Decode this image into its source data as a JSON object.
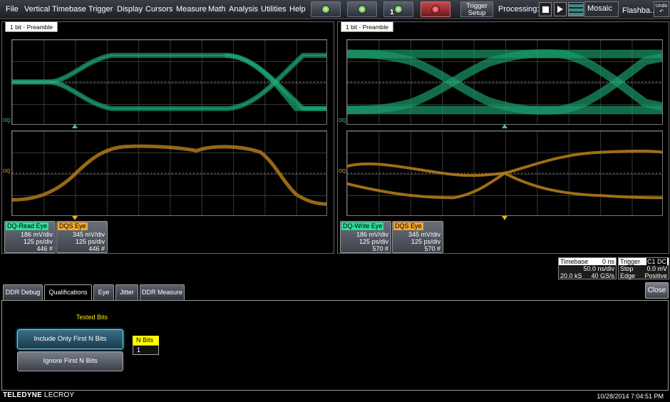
{
  "menu": [
    "File",
    "Vertical",
    "Timebase",
    "Trigger",
    "Display",
    "Cursors",
    "Measure",
    "Math",
    "Analysis",
    "Utilities",
    "Help"
  ],
  "toolbar": {
    "trigger_setup_line1": "Trigger",
    "trigger_setup_line2": "Setup",
    "processing_label": "Processing:",
    "single_count": "1",
    "mosaic_label": "Mosaic",
    "flashback_label": "Flashba...",
    "undo_label": "Undo",
    "colors": {
      "active_red": "#c8474a",
      "led_green": "#3aa036"
    }
  },
  "left_panel": {
    "tab": "1 bit - Preamble",
    "dq_channel": "DQ",
    "dqs_channel": "DQ",
    "traces": [
      {
        "label": "DQ-Read Eye",
        "color": "#2ee09a",
        "vdiv": "186 mV/div",
        "tdiv": "125 ps/div",
        "count": "446 #"
      },
      {
        "label": "DQS Eye",
        "color": "#f0a830",
        "vdiv": "345 mV/div",
        "tdiv": "125 ps/div",
        "count": "446 #"
      }
    ]
  },
  "right_panel": {
    "tab": "1 bit - Preamble",
    "dq_channel": "DQ",
    "dqs_channel": "DQ",
    "traces": [
      {
        "label": "DQ-Write Eye",
        "color": "#2ee09a",
        "vdiv": "186 mV/div",
        "tdiv": "125 ps/div",
        "count": "570 #"
      },
      {
        "label": "DQS Eye",
        "color": "#f0a830",
        "vdiv": "345 mV/div",
        "tdiv": "125 ps/div",
        "count": "570 #"
      }
    ]
  },
  "colors": {
    "eye_green": "#1a9a6a",
    "eye_orange": "#b07a18"
  },
  "timebase": {
    "title": "Timebase",
    "delay": "0 ns",
    "tdiv": "50.0 ns/div",
    "samples": "20.0 kS",
    "rate": "40 GS/s"
  },
  "trigger": {
    "title": "Trigger",
    "source": "C1 DC",
    "mode": "Stop",
    "level": "0.0 mV",
    "type": "Edge",
    "slope": "Positive"
  },
  "dialog": {
    "tabs": [
      "DDR Debug",
      "Qualifications",
      "Eye",
      "Jitter",
      "DDR Measure"
    ],
    "active_tab": "Qualifications",
    "close_label": "Close",
    "tested_bits_title": "Tested Bits",
    "option_include": "Include Only First N Bits",
    "option_ignore": "Ignore First N Bits",
    "nbits_label": "N Bits",
    "nbits_value": "1"
  },
  "footer": {
    "brand_bold": "TELEDYNE",
    "brand_normal": " LECROY",
    "datetime": "10/28/2014 7:04:51 PM"
  }
}
